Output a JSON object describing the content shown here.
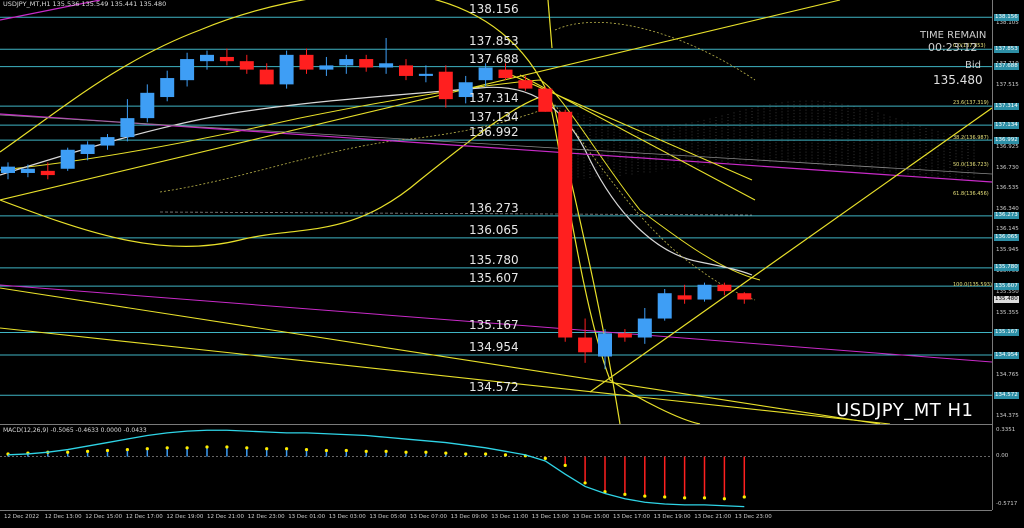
{
  "header": {
    "symbol_info": "USDJPY_MT,H1  135.536 135.549 135.441 135.480"
  },
  "levels": [
    {
      "price": "138.156"
    },
    {
      "price": "137.853"
    },
    {
      "price": "137.688"
    },
    {
      "price": "137.314"
    },
    {
      "price": "137.134"
    },
    {
      "price": "136.992"
    },
    {
      "price": "136.273"
    },
    {
      "price": "136.065"
    },
    {
      "price": "135.780"
    },
    {
      "price": "135.607"
    },
    {
      "price": "135.167"
    },
    {
      "price": "134.954"
    },
    {
      "price": "134.572"
    }
  ],
  "timer": {
    "title": "TIME REMAIN",
    "value": "00:23:12"
  },
  "bid": {
    "title": "Bid",
    "value": "135.480"
  },
  "watermark": "USDJPY_MT H1",
  "fib_tags": [
    {
      "text": "0.0(137.853)"
    },
    {
      "text": "23.6(137.319)"
    },
    {
      "text": "38.2(136.987)"
    },
    {
      "text": "50.0(136.723)"
    },
    {
      "text": "61.8(136.456)"
    },
    {
      "text": "100.0(135.593)"
    }
  ],
  "price_scale": {
    "ticks": [
      "138.105",
      "137.710",
      "137.515",
      "137.120",
      "136.925",
      "136.730",
      "136.535",
      "136.340",
      "136.145",
      "135.945",
      "135.750",
      "135.550",
      "135.355",
      "135.160",
      "134.765",
      "134.570",
      "134.375",
      "0.3351",
      "0.00",
      "-0.5717"
    ],
    "boxed": [
      "138.156",
      "137.853",
      "137.688",
      "137.314",
      "137.134",
      "136.992",
      "136.273",
      "136.065",
      "135.780",
      "135.607",
      "135.480",
      "135.167",
      "134.954",
      "134.572"
    ]
  },
  "macd": {
    "label": "MACD(12,26,9) -0.5065 -0.4633 0.0000 -0.0433"
  },
  "time_axis": {
    "labels": [
      "12 Dec 2022",
      "12 Dec 13:00",
      "12 Dec 15:00",
      "12 Dec 17:00",
      "12 Dec 19:00",
      "12 Dec 21:00",
      "12 Dec 23:00",
      "13 Dec 01:00",
      "13 Dec 03:00",
      "13 Dec 05:00",
      "13 Dec 07:00",
      "13 Dec 09:00",
      "13 Dec 11:00",
      "13 Dec 13:00",
      "13 Dec 15:00",
      "13 Dec 17:00",
      "13 Dec 19:00",
      "13 Dec 21:00",
      "13 Dec 23:00"
    ]
  },
  "colors": {
    "bull": "#3e9ef5",
    "bear": "#ff1f1f",
    "level_line": "#3fb4c4",
    "yellow": "#e8e02a",
    "magenta": "#c82ac8",
    "macd_signal": "#2fd4e6",
    "macd_dots": "#ffee00"
  },
  "chart_data": {
    "type": "candlestick",
    "candles": [
      {
        "o": 136.68,
        "h": 136.78,
        "l": 136.62,
        "c": 136.74
      },
      {
        "o": 136.68,
        "h": 136.76,
        "l": 136.64,
        "c": 136.72
      },
      {
        "o": 136.7,
        "h": 136.78,
        "l": 136.62,
        "c": 136.66
      },
      {
        "o": 136.72,
        "h": 136.92,
        "l": 136.7,
        "c": 136.9
      },
      {
        "o": 136.86,
        "h": 136.98,
        "l": 136.8,
        "c": 136.95
      },
      {
        "o": 136.94,
        "h": 137.05,
        "l": 136.9,
        "c": 137.02
      },
      {
        "o": 137.02,
        "h": 137.38,
        "l": 136.98,
        "c": 137.2
      },
      {
        "o": 137.2,
        "h": 137.52,
        "l": 137.16,
        "c": 137.44
      },
      {
        "o": 137.4,
        "h": 137.65,
        "l": 137.36,
        "c": 137.58
      },
      {
        "o": 137.56,
        "h": 137.82,
        "l": 137.5,
        "c": 137.76
      },
      {
        "o": 137.74,
        "h": 137.84,
        "l": 137.66,
        "c": 137.8
      },
      {
        "o": 137.78,
        "h": 137.86,
        "l": 137.7,
        "c": 137.74
      },
      {
        "o": 137.74,
        "h": 137.8,
        "l": 137.62,
        "c": 137.66
      },
      {
        "o": 137.66,
        "h": 137.72,
        "l": 137.52,
        "c": 137.52
      },
      {
        "o": 137.52,
        "h": 137.84,
        "l": 137.48,
        "c": 137.8
      },
      {
        "o": 137.8,
        "h": 137.86,
        "l": 137.62,
        "c": 137.66
      },
      {
        "o": 137.66,
        "h": 137.78,
        "l": 137.6,
        "c": 137.7
      },
      {
        "o": 137.7,
        "h": 137.8,
        "l": 137.62,
        "c": 137.76
      },
      {
        "o": 137.76,
        "h": 137.8,
        "l": 137.64,
        "c": 137.68
      },
      {
        "o": 137.68,
        "h": 137.96,
        "l": 137.62,
        "c": 137.72
      },
      {
        "o": 137.7,
        "h": 137.76,
        "l": 137.56,
        "c": 137.6
      },
      {
        "o": 137.6,
        "h": 137.7,
        "l": 137.54,
        "c": 137.62
      },
      {
        "o": 137.64,
        "h": 137.7,
        "l": 137.3,
        "c": 137.38
      },
      {
        "o": 137.4,
        "h": 137.6,
        "l": 137.34,
        "c": 137.54
      },
      {
        "o": 137.56,
        "h": 137.72,
        "l": 137.5,
        "c": 137.68
      },
      {
        "o": 137.66,
        "h": 137.72,
        "l": 137.56,
        "c": 137.58
      },
      {
        "o": 137.56,
        "h": 137.6,
        "l": 137.46,
        "c": 137.48
      },
      {
        "o": 137.48,
        "h": 137.5,
        "l": 137.26,
        "c": 137.26
      },
      {
        "o": 137.26,
        "h": 137.28,
        "l": 135.08,
        "c": 135.12
      },
      {
        "o": 135.12,
        "h": 135.3,
        "l": 134.88,
        "c": 134.98
      },
      {
        "o": 134.94,
        "h": 135.2,
        "l": 134.82,
        "c": 135.16
      },
      {
        "o": 135.16,
        "h": 135.2,
        "l": 135.08,
        "c": 135.12
      },
      {
        "o": 135.12,
        "h": 135.4,
        "l": 135.06,
        "c": 135.3
      },
      {
        "o": 135.3,
        "h": 135.58,
        "l": 135.28,
        "c": 135.54
      },
      {
        "o": 135.52,
        "h": 135.62,
        "l": 135.44,
        "c": 135.48
      },
      {
        "o": 135.48,
        "h": 135.64,
        "l": 135.46,
        "c": 135.62
      },
      {
        "o": 135.62,
        "h": 135.64,
        "l": 135.52,
        "c": 135.56
      },
      {
        "o": 135.54,
        "h": 135.55,
        "l": 135.44,
        "c": 135.48
      }
    ],
    "price_range": [
      134.3,
      138.32
    ],
    "macd_hist": [
      0.03,
      0.04,
      0.05,
      0.05,
      0.06,
      0.07,
      0.08,
      0.09,
      0.1,
      0.1,
      0.11,
      0.11,
      0.1,
      0.09,
      0.09,
      0.08,
      0.07,
      0.07,
      0.06,
      0.06,
      0.05,
      0.05,
      0.04,
      0.03,
      0.03,
      0.02,
      0.01,
      -0.02,
      -0.1,
      -0.3,
      -0.4,
      -0.43,
      -0.45,
      -0.46,
      -0.47,
      -0.47,
      -0.48,
      -0.46
    ],
    "macd_signal": [
      0.02,
      0.03,
      0.05,
      0.08,
      0.12,
      0.16,
      0.2,
      0.24,
      0.27,
      0.29,
      0.3,
      0.3,
      0.29,
      0.28,
      0.27,
      0.27,
      0.26,
      0.25,
      0.24,
      0.22,
      0.2,
      0.18,
      0.16,
      0.13,
      0.1,
      0.06,
      0.02,
      -0.05,
      -0.2,
      -0.34,
      -0.42,
      -0.48,
      -0.52,
      -0.54,
      -0.55,
      -0.55,
      -0.56,
      -0.57
    ],
    "macd_range": [
      -0.62,
      0.36
    ]
  }
}
